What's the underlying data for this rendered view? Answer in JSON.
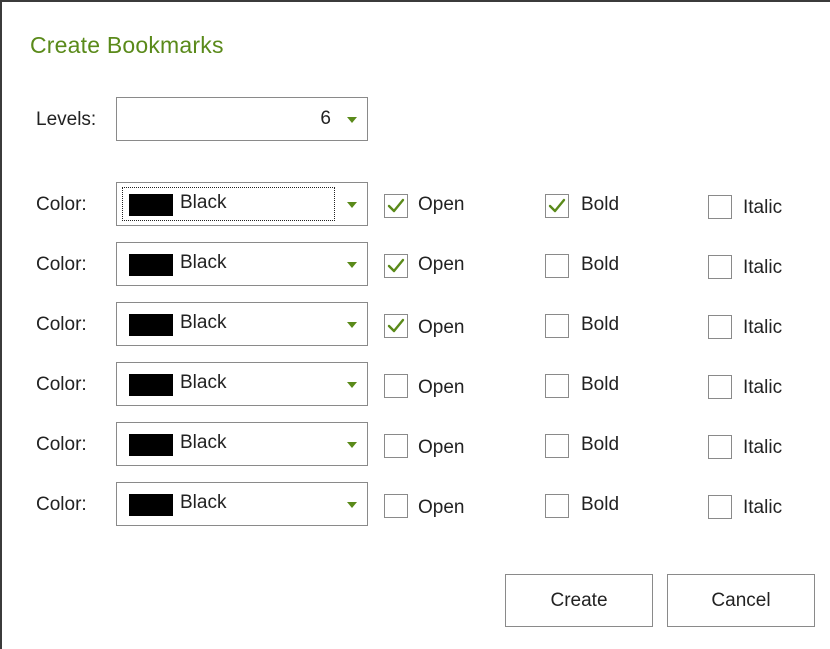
{
  "dialog": {
    "title": "Create Bookmarks"
  },
  "levels": {
    "label": "Levels:",
    "value": "6"
  },
  "rows": [
    {
      "color_label": "Color:",
      "color_name": "Black",
      "swatch": "#000000",
      "open": true,
      "bold": true,
      "italic": false
    },
    {
      "color_label": "Color:",
      "color_name": "Black",
      "swatch": "#000000",
      "open": true,
      "bold": false,
      "italic": false
    },
    {
      "color_label": "Color:",
      "color_name": "Black",
      "swatch": "#000000",
      "open": true,
      "bold": false,
      "italic": false
    },
    {
      "color_label": "Color:",
      "color_name": "Black",
      "swatch": "#000000",
      "open": false,
      "bold": false,
      "italic": false
    },
    {
      "color_label": "Color:",
      "color_name": "Black",
      "swatch": "#000000",
      "open": false,
      "bold": false,
      "italic": false
    },
    {
      "color_label": "Color:",
      "color_name": "Black",
      "swatch": "#000000",
      "open": false,
      "bold": false,
      "italic": false
    }
  ],
  "checkbox_labels": {
    "open": "Open",
    "bold": "Bold",
    "italic": "Italic"
  },
  "buttons": {
    "create": "Create",
    "cancel": "Cancel"
  },
  "colors": {
    "accent": "#5a8a1a",
    "border": "#8a8a8a"
  }
}
